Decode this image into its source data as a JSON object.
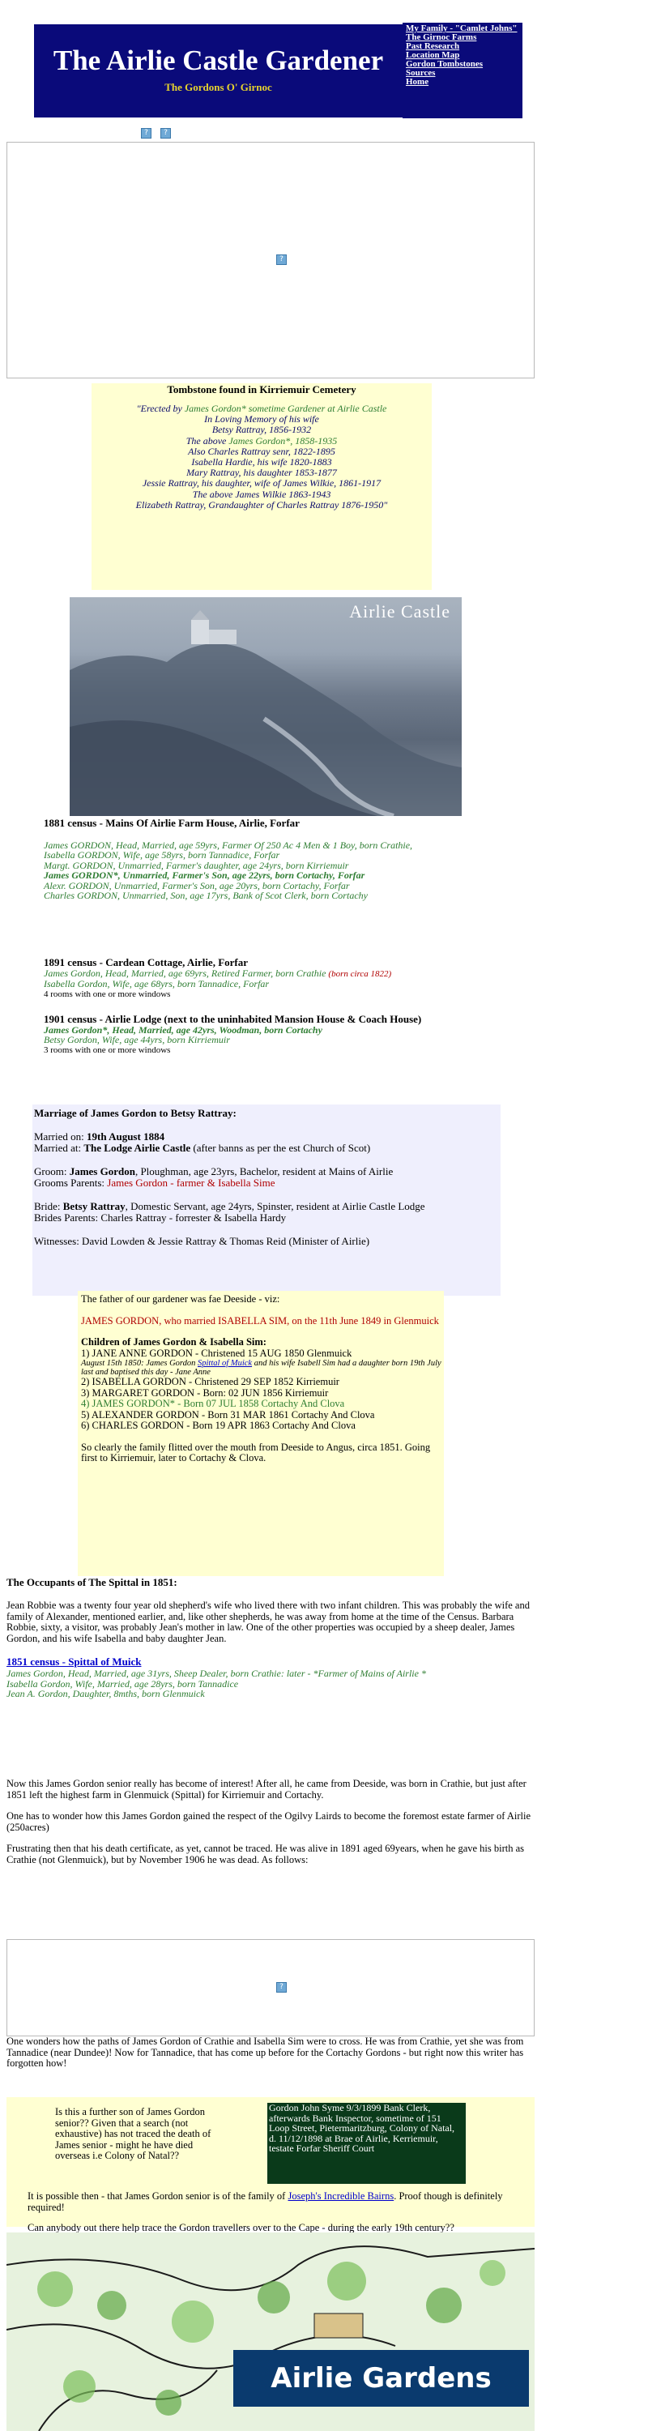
{
  "banner": {
    "title": "The Airlie Castle Gardener",
    "subtitle": "The Gordons O' Girnoc"
  },
  "nav": [
    "My Family - \"Camlet Johns\"",
    "The Girnoc Farms",
    "Past Research",
    "Location Map",
    "Gordon Tombstones",
    "Sources",
    "Home"
  ],
  "help_icon": "?",
  "tombstone": {
    "heading": "Tombstone found in Kirriemuir Cemetery",
    "lines": [
      [
        "\"Erected by ",
        "James Gordon* sometime Gardener at Airlie Castle"
      ],
      [
        "In Loving Memory of his wife",
        ""
      ],
      [
        "Betsy Rattray, 1856-1932",
        ""
      ],
      [
        "The above ",
        "James Gordon*, 1858-1935"
      ],
      [
        "Also Charles Rattray senr, 1822-1895",
        ""
      ],
      [
        "Isabella Hardie, his wife 1820-1883",
        ""
      ],
      [
        "Mary Rattray, his daughter 1853-1877",
        ""
      ],
      [
        "Jessie Rattray, his daughter, wife of James Wilkie, 1861-1917",
        ""
      ],
      [
        "The above James Wilkie 1863-1943",
        ""
      ],
      [
        "Elizabeth Rattray, Grandaughter of Charles Rattray 1876-1950\"",
        ""
      ]
    ]
  },
  "airlie_image": {
    "title": "Airlie Castle",
    "icon": "castle-photo-icon"
  },
  "census1881": {
    "heading": "1881 census - Mains Of Airlie Farm House, Airlie, Forfar",
    "rows": [
      "James GORDON, Head, Married, age 59yrs, Farmer Of 250 Ac 4 Men & 1 Boy, born Crathie,",
      "Isabella GORDON, Wife, age 58yrs, born Tannadice, Forfar",
      "Margt. GORDON, Unmarried, Farmer's daughter, age 24yrs, born Kirriemuir",
      "James GORDON*, Unmarried, Farmer's Son, age 22yrs, born Cortachy, Forfar",
      "Alexr. GORDON, Unmarried, Farmer's Son, age 20yrs, born Cortachy, Forfar",
      "Charles GORDON, Unmarried, Son, age 17yrs, Bank of Scot Clerk, born Cortachy"
    ]
  },
  "census1891": {
    "heading": "1891 census - Cardean Cottage, Airlie, Forfar",
    "row1": "James Gordon, Head, Married, age 69yrs, Retired Farmer, born Crathie",
    "row1_red": "(born circa 1822)",
    "row2": "Isabella Gordon, Wife, age 68yrs, born Tannadice, Forfar",
    "note": "4 rooms with one or more windows"
  },
  "census1901": {
    "heading": "1901 census - Airlie Lodge (next to the uninhabited Mansion House & Coach House)",
    "row1": "James Gordon*, Head, Married, age 42yrs, Woodman, born Cortachy",
    "row2": "Betsy Gordon, Wife, age 44yrs, born Kirriemuir",
    "note": "3 rooms with one or more windows"
  },
  "marriage": {
    "heading": "Marriage of James Gordon to Betsy Rattray:",
    "married_on_label": "Married on: ",
    "married_on": "19th August 1884",
    "married_at_label": "Married at: ",
    "married_at": "The Lodge Airlie Castle",
    "married_at_note": " (after banns as per the est Church of Scot)",
    "groom_label": "Groom: ",
    "groom": "James Gordon",
    "groom_detail": ", Ploughman, age 23yrs, Bachelor, resident at Mains of Airlie",
    "groom_parents_label": "Grooms Parents: ",
    "groom_parents": "James Gordon - farmer & Isabella Sime",
    "bride_label": "Bride: ",
    "bride": "Betsy Rattray",
    "bride_detail": ", Domestic Servant, age 24yrs, Spinster, resident at Airlie Castle Lodge",
    "bride_parents": "Brides Parents: Charles Rattray - forrester & Isabella Hardy",
    "witnesses": "Witnesses: David Lowden & Jessie Rattray & Thomas Reid (Minister of Airlie)"
  },
  "children": {
    "intro": "The father of our gardener was fae Deeside - viz:",
    "married_line": "JAMES GORDON, who married ISABELLA SIM, on the 11th June 1849 in Glenmuick",
    "heading": "Children of James Gordon & Isabella Sim:",
    "c1": "1) JANE ANNE GORDON - Christened 15 AUG 1850 Glenmuick",
    "c1_note_a": "August 15th 1850: James Gordon ",
    "c1_note_link": "Spittal of Muick",
    "c1_note_b": " and his wife Isabell Sim had a daughter born 19th July last and baptised this day - Jane Anne",
    "c2": "2) ISABELLA GORDON - Christened 29 SEP 1852 Kirriemuir",
    "c3": "3) MARGARET GORDON - Born: 02 JUN 1856 Kirriemuir",
    "c4": "4) JAMES GORDON* - Born 07 JUL 1858 Cortachy And Clova",
    "c5": "5) ALEXANDER GORDON - Born 31 MAR 1861 Cortachy And Clova",
    "c6": "6) CHARLES GORDON - Born 19 APR 1863 Cortachy And Clova",
    "summary": "So clearly the family flitted over the mouth from Deeside to Angus, circa 1851. Going first to Kirriemuir, later to Cortachy & Clova."
  },
  "spittal": {
    "heading": "The Occupants of The Spittal in 1851:",
    "para": "Jean Robbie was a twenty four year old shepherd's wife who lived there with two infant children. This was probably the wife and family of Alexander, mentioned earlier, and, like other shepherds, he was away from home at the time of the Census. Barbara Robbie, sixty, a visitor, was probably Jean's mother in law. One of the other properties was occupied by a sheep dealer, James Gordon, and his wife Isabella and baby daughter Jean.",
    "census_link": "1851 census - Spittal of Muick",
    "row1": "James Gordon, Head, Married, age 31yrs, Sheep Dealer, born Crathie: later - *Farmer of Mains of Airlie *",
    "row2": "Isabella Gordon, Wife, Married, age 28yrs, born Tannadice",
    "row3": "Jean A. Gordon, Daughter, 8mths, born Glenmuick"
  },
  "senior": {
    "p1": "Now this James Gordon senior really has become of interest! After all, he came from Deeside, was born in Crathie, but just after 1851 left the highest farm in Glenmuick (Spittal) for Kirriemuir and Cortachy.",
    "p2": "One has to wonder how this James Gordon gained the respect of the Ogilvy Lairds to become the foremost estate farmer of Airlie (250acres)",
    "p3": "Frustrating then that his death certificate, as yet, cannot be traced. He was alive in 1891 aged 69years, when he gave his birth as Crathie (not Glenmuick), but by November 1906 he was dead. As follows:"
  },
  "wonder": {
    "text": "One wonders how the paths of James Gordon of Crathie and Isabella Sim were to cross. He was from Crathie, yet she was from Tannadice (near Dundee)! Now for Tannadice, that has come up before for the Cortachy Gordons - but right now this writer has forgotten how!"
  },
  "son_question": {
    "text": "Is this a further son of James Gordon senior?? Given that a search (not exhaustive) has not traced the death of James senior - might he have died overseas i.e Colony of Natal??",
    "natal_record": "Gordon    John Syme    9/3/1899    Bank Clerk, afterwards Bank Inspector, sometime of 151 Loop Street, Pietermaritzburg, Colony of Natal, d. 11/12/1898 at Brae of Airlie, Kerriemuir, testate Forfar Sheriff Court",
    "family_a": "It is possible then - that James Gordon senior is of the family of ",
    "family_link": "Joseph's Incredible Bairns",
    "family_b": ". Proof though is definitely required!",
    "plea": "Can anybody out there help trace the Gordon travellers over to the Cape - during the early 19th century??"
  },
  "gardens": {
    "title": "Airlie Gardens",
    "icon": "garden-map-icon"
  }
}
